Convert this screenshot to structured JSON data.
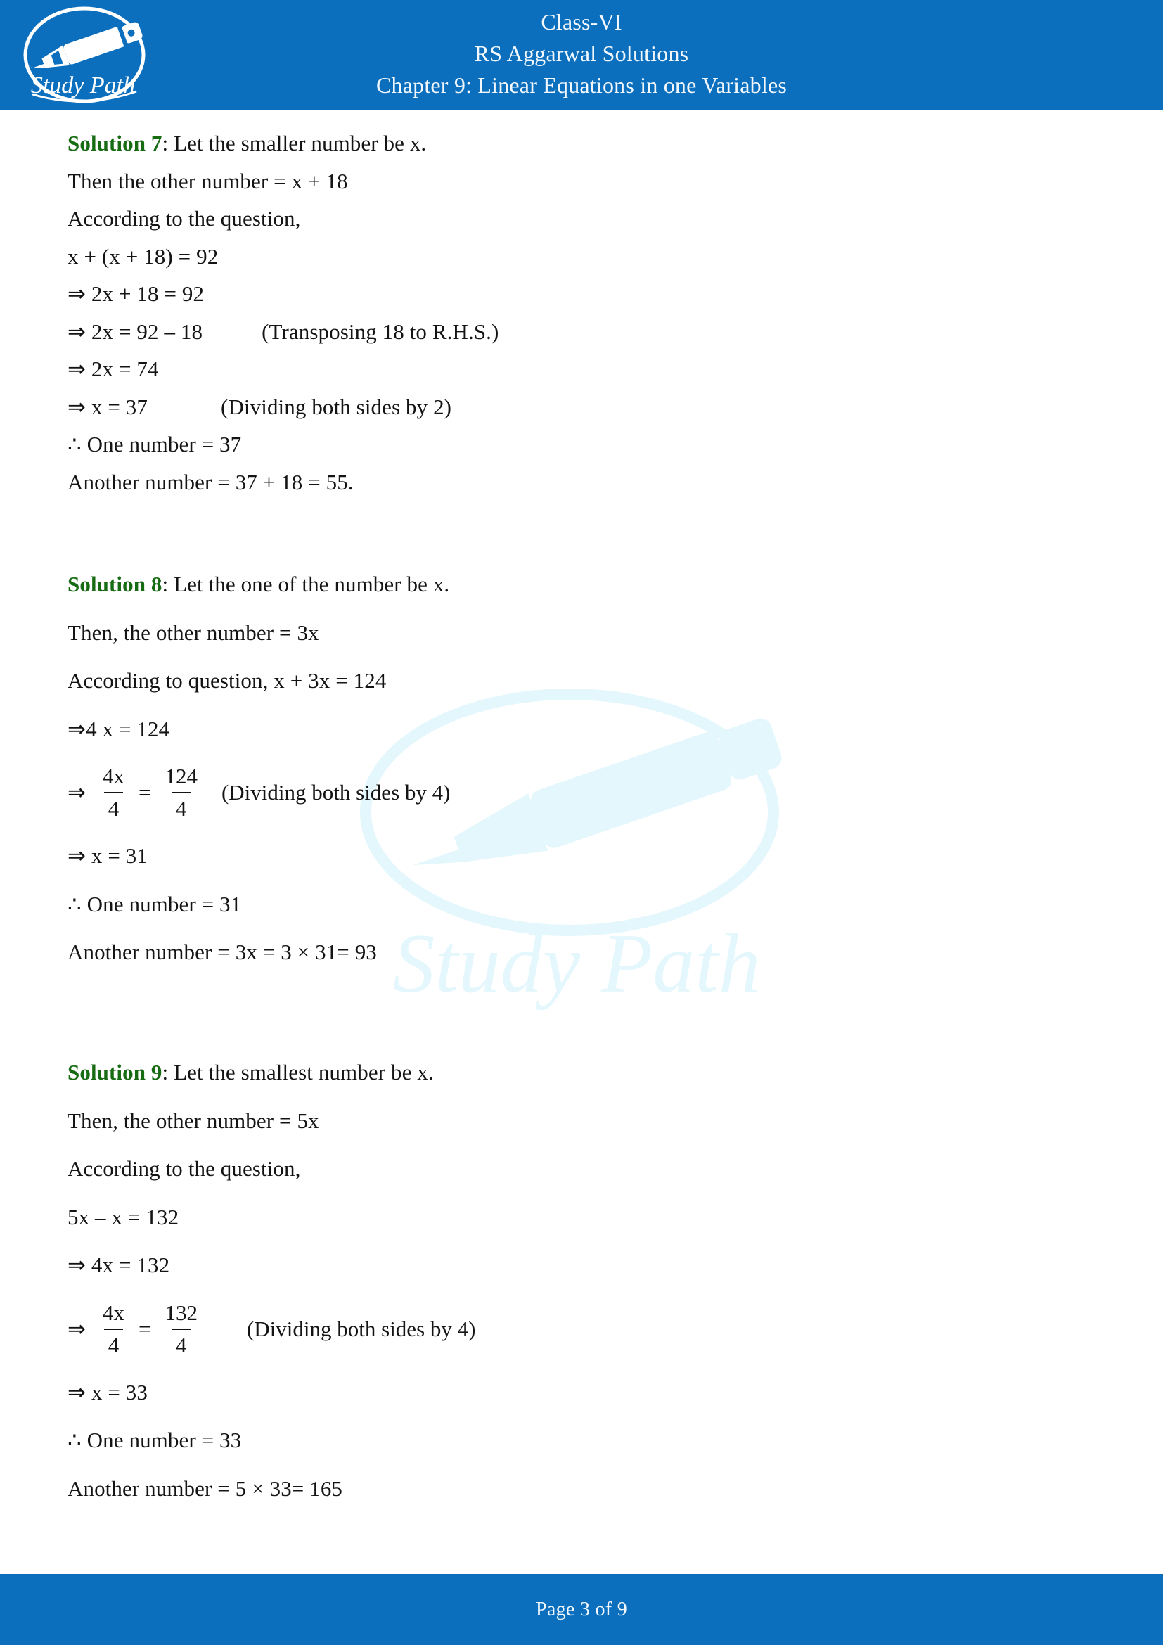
{
  "header": {
    "logo_alt": "Study Path logo",
    "logo_text": "Study Path",
    "line1": "Class-VI",
    "line2": "RS Aggarwal Solutions",
    "line3": "Chapter 9: Linear Equations in one Variables",
    "background_color": "#0b6fbd",
    "text_color": "#f2f8fd"
  },
  "watermark": {
    "text": "Study Path",
    "color": "#e2f6fc"
  },
  "solutions": [
    {
      "label": "Solution 7",
      "label_color": "#176b12",
      "intro": ": Let the smaller number be x.",
      "lines": [
        {
          "text": "Then the other number = x + 18"
        },
        {
          "text": "According to the question,"
        },
        {
          "text": " x + (x + 18) = 92"
        },
        {
          "text": "⇒ 2x + 18 = 92"
        },
        {
          "text": "⇒ 2x = 92 – 18",
          "note": "(Transposing 18 to R.H.S.)"
        },
        {
          "text": "⇒ 2x = 74"
        },
        {
          "text": "⇒ x = 37",
          "note": "(Dividing both sides by 2)"
        },
        {
          "text": "∴ One number = 37"
        },
        {
          "text": "Another number = 37 + 18 = 55."
        }
      ]
    },
    {
      "label": "Solution 8",
      "label_color": "#176b12",
      "intro": ": Let the one of the number be x.",
      "lines": [
        {
          "text": "Then, the other number = 3x"
        },
        {
          "text": "According to question, x + 3x = 124"
        },
        {
          "text": "⇒4 x = 124"
        }
      ],
      "fraction": {
        "arrow": "⇒",
        "left_num": "4x",
        "left_den": "4",
        "equals": "=",
        "right_num": "124",
        "right_den": "4",
        "note": "(Dividing both sides by 4)"
      },
      "lines_after": [
        {
          "text": "⇒ x = 31"
        },
        {
          "text": "∴ One number = 31"
        },
        {
          "text": "Another number = 3x = 3 × 31= 93"
        }
      ]
    },
    {
      "label": "Solution 9",
      "label_color": "#176b12",
      "intro": ": Let the smallest number be x.",
      "lines": [
        {
          "text": "Then, the other number = 5x"
        },
        {
          "text": "According to the question,"
        },
        {
          "text": "5x – x = 132"
        },
        {
          "text": "⇒ 4x = 132"
        }
      ],
      "fraction": {
        "arrow": "⇒",
        "left_num": "4x",
        "left_den": "4",
        "equals": "=",
        "right_num": "132",
        "right_den": "4",
        "note": "(Dividing both sides by 4)"
      },
      "lines_after": [
        {
          "text": "⇒ x = 33"
        },
        {
          "text": "∴ One number = 33"
        },
        {
          "text": "Another number = 5 × 33= 165"
        }
      ]
    }
  ],
  "footer": {
    "page_text": "Page 3 of 9",
    "background_color": "#0b6fbd",
    "text_color": "#f2f8fd"
  }
}
